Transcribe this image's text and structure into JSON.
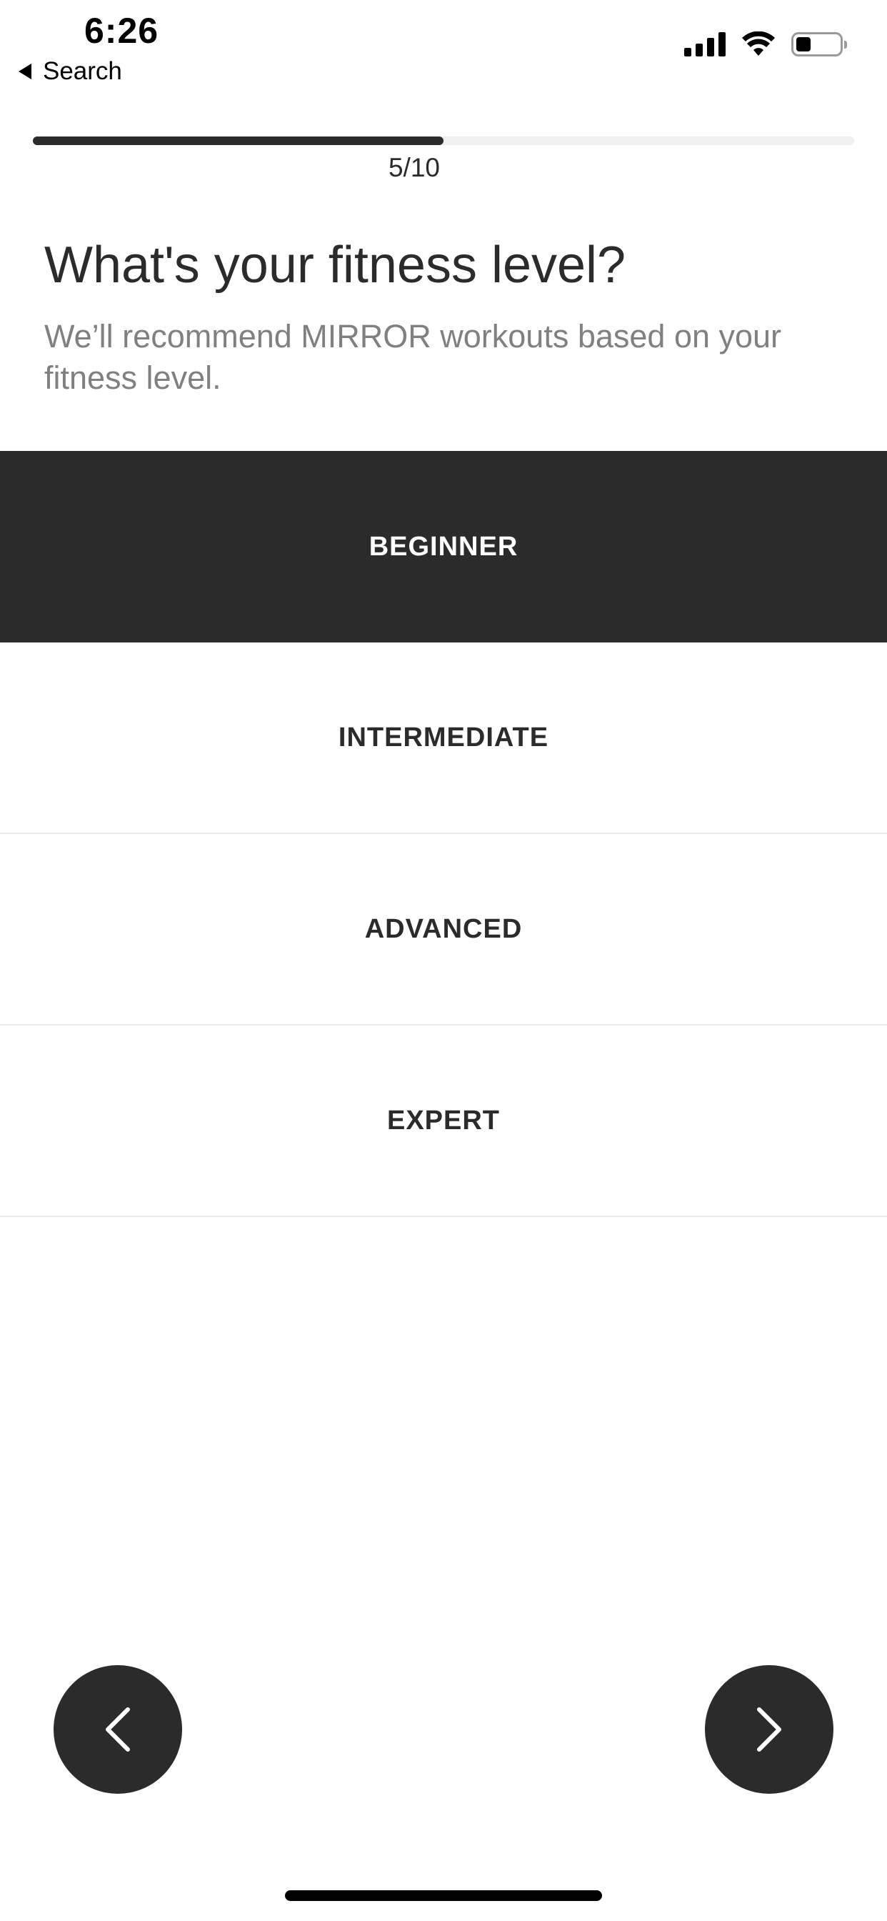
{
  "status_bar": {
    "time": "6:26",
    "back_label": "Search"
  },
  "progress": {
    "label": "5/10",
    "current": 5,
    "total": 10
  },
  "heading": {
    "title": "What's your fitness level?",
    "subtitle": "We’ll recommend MIRROR workouts based on your fitness level."
  },
  "options": [
    {
      "label": "BEGINNER",
      "selected": true
    },
    {
      "label": "INTERMEDIATE",
      "selected": false
    },
    {
      "label": "ADVANCED",
      "selected": false
    },
    {
      "label": "EXPERT",
      "selected": false
    }
  ],
  "navigation": {
    "back_icon": "chevron-left-icon",
    "next_icon": "chevron-right-icon"
  },
  "colors": {
    "accent": "#2b2b2b",
    "subtitle": "#808080",
    "track": "#f0f0f0"
  }
}
